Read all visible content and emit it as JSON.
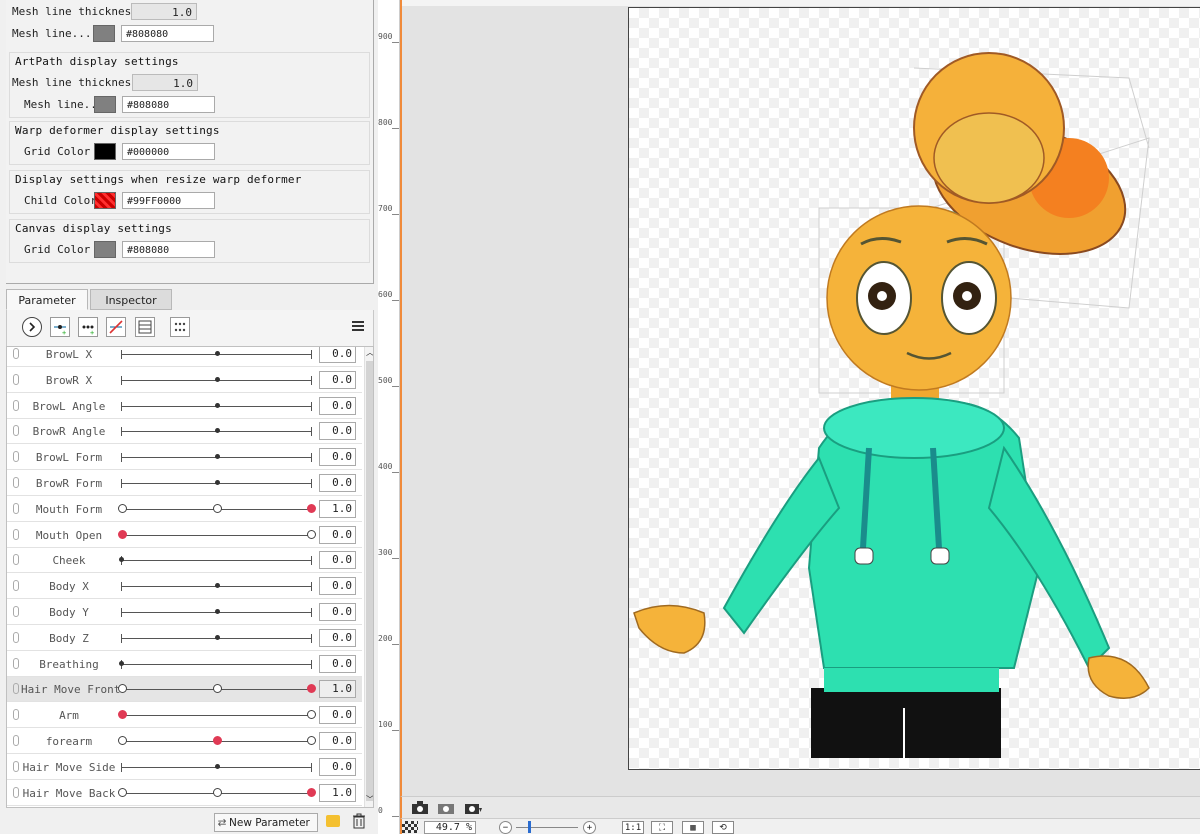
{
  "settings": {
    "rows": [
      {
        "label": "Mesh line thickness",
        "value": "1.0"
      },
      {
        "label": "Mesh line...",
        "color_hex": "#808080",
        "swatch": "#808080"
      }
    ],
    "groups": [
      {
        "title": "ArtPath display settings",
        "rows": [
          {
            "label": "Mesh line thickness",
            "value": "1.0"
          },
          {
            "label": "Mesh line...",
            "color_hex": "#808080",
            "swatch": "#808080"
          }
        ]
      },
      {
        "title": "Warp deformer display settings",
        "rows": [
          {
            "label": "Grid Color",
            "color_hex": "#000000",
            "swatch": "#000000"
          }
        ]
      },
      {
        "title": "Display settings when resize warp deformer",
        "rows": [
          {
            "label": "Child Color",
            "color_hex": "#99FF0000",
            "swatch": "#ff2020"
          }
        ]
      },
      {
        "title": "Canvas display settings",
        "rows": [
          {
            "label": "Grid Color",
            "color_hex": "#808080",
            "swatch": "#808080"
          }
        ]
      }
    ]
  },
  "tabs": [
    {
      "label": "Parameter",
      "active": true
    },
    {
      "label": "Inspector",
      "active": false
    }
  ],
  "toolbar": {
    "icons": [
      "circle-arrow-icon",
      "add-key-icon",
      "add-keys-icon",
      "delete-key-icon",
      "parameter-grid-icon",
      "key-layout-icon",
      "menu-icon"
    ]
  },
  "parameters": [
    {
      "name": "BrowL X",
      "value": "0.0",
      "keys": [],
      "pos": 0.5
    },
    {
      "name": "BrowR X",
      "value": "0.0",
      "keys": [],
      "pos": 0.5
    },
    {
      "name": "BrowL Angle",
      "value": "0.0",
      "keys": [],
      "pos": 0.5
    },
    {
      "name": "BrowR Angle",
      "value": "0.0",
      "keys": [],
      "pos": 0.5
    },
    {
      "name": "BrowL Form",
      "value": "0.0",
      "keys": [],
      "pos": 0.5
    },
    {
      "name": "BrowR Form",
      "value": "0.0",
      "keys": [],
      "pos": 0.5
    },
    {
      "name": "Mouth Form",
      "value": "1.0",
      "keys": [
        0,
        0.5,
        1
      ],
      "active": 1,
      "pos": 1
    },
    {
      "name": "Mouth Open",
      "value": "0.0",
      "keys": [
        0,
        1
      ],
      "active": 0,
      "pos": 0
    },
    {
      "name": "Cheek",
      "value": "0.0",
      "keys": [],
      "pos": 0
    },
    {
      "name": "Body X",
      "value": "0.0",
      "keys": [],
      "pos": 0.5
    },
    {
      "name": "Body Y",
      "value": "0.0",
      "keys": [],
      "pos": 0.5
    },
    {
      "name": "Body Z",
      "value": "0.0",
      "keys": [],
      "pos": 0.5
    },
    {
      "name": "Breathing",
      "value": "0.0",
      "keys": [],
      "pos": 0
    },
    {
      "name": "Hair Move Front",
      "value": "1.0",
      "keys": [
        0,
        0.5,
        1
      ],
      "active": 1,
      "pos": 1,
      "selected": true
    },
    {
      "name": "Arm",
      "value": "0.0",
      "keys": [
        0,
        1
      ],
      "active": 0,
      "pos": 0
    },
    {
      "name": "forearm",
      "value": "0.0",
      "keys": [
        0,
        0.5,
        1
      ],
      "active": 0.5,
      "pos": 0.5
    },
    {
      "name": "Hair Move Side",
      "value": "0.0",
      "keys": [],
      "pos": 0.5
    },
    {
      "name": "Hair Move Back",
      "value": "1.0",
      "keys": [
        0,
        0.5,
        1
      ],
      "active": 1,
      "pos": 1
    }
  ],
  "footer": {
    "new_parameter": "New Parameter"
  },
  "ruler": [
    "900",
    "800",
    "700",
    "600",
    "500",
    "400",
    "300",
    "200",
    "100",
    "0"
  ],
  "status": {
    "zoom": "49.7 %",
    "one_to_one": "1:1"
  },
  "colors": {
    "accent": "#f08a3a",
    "key_active": "#e03a55",
    "hoodie": "#2de0b0",
    "hair": "#f5b13a",
    "skin": "#f5b33a"
  }
}
